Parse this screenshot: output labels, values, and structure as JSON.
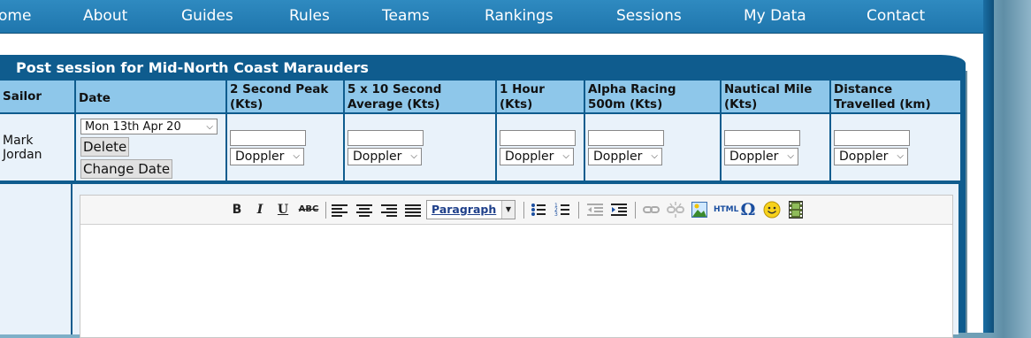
{
  "nav": {
    "items": [
      "ome",
      "About",
      "Guides",
      "Rules",
      "Teams",
      "Rankings",
      "Sessions",
      "My Data",
      "Contact"
    ]
  },
  "panel": {
    "title": "Post session for Mid-North Coast Marauders"
  },
  "table": {
    "headers": {
      "sailor": "Sailor",
      "date": "Date",
      "peak2": "2 Second Peak (Kts)",
      "avg5x10": "5 x 10 Second Average (Kts)",
      "hour1": "1 Hour (Kts)",
      "alpha500": "Alpha Racing 500m (Kts)",
      "nautical": "Nautical Mile (Kts)",
      "distance": "Distance Travelled (km)"
    },
    "row": {
      "sailor": "Mark Jordan",
      "date_value": "Mon 13th Apr 20",
      "delete_label": "Delete",
      "change_date_label": "Change Date",
      "device_value": "Doppler"
    }
  },
  "editor": {
    "format_value": "Paragraph",
    "toolbar": {
      "bold": "B",
      "italic": "I",
      "underline": "U",
      "strike": "ABC",
      "html": "HTML",
      "omega": "Ω"
    }
  },
  "colors": {
    "nav_bg": "#2282b8",
    "panel_bg": "#0f5c8e",
    "header_bg": "#8ec7ea",
    "cell_bg": "#e9f2fa"
  }
}
